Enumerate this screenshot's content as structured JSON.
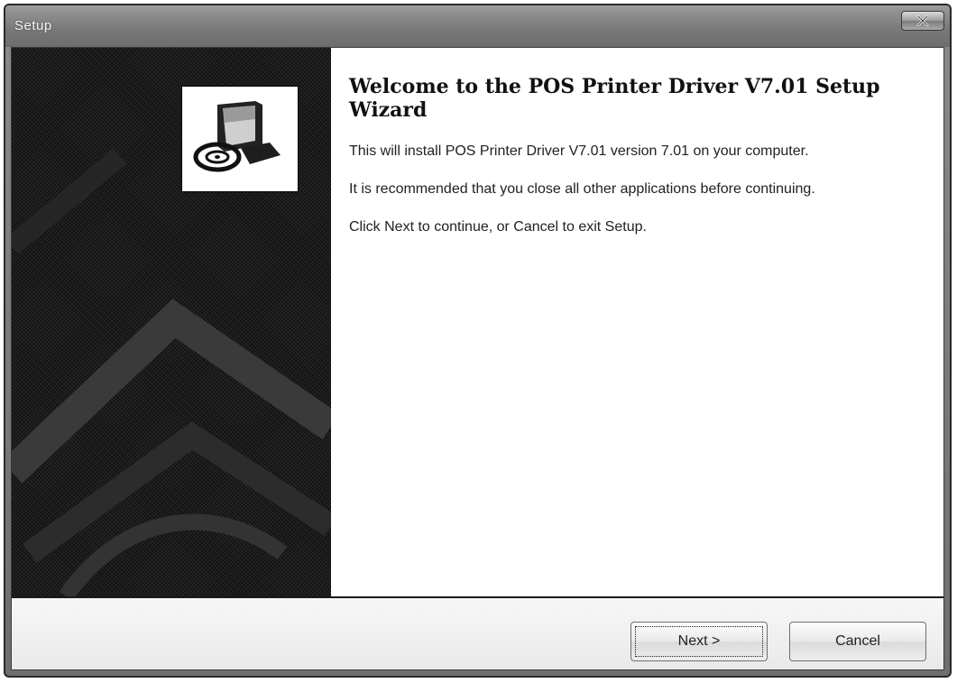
{
  "window": {
    "title": "Setup",
    "close_icon": "close-icon"
  },
  "side_panel": {
    "logo_icon": "computer-setup-icon"
  },
  "content": {
    "title": "Welcome to the POS Printer Driver V7.01 Setup Wizard",
    "paragraphs": [
      "This will install POS Printer Driver V7.01 version 7.01 on your computer.",
      "It is recommended that you close all other applications before continuing.",
      "Click Next to continue, or Cancel to exit Setup."
    ]
  },
  "buttons": {
    "next_label": "Next >",
    "cancel_label": "Cancel"
  },
  "colors": {
    "side_panel": "#121212",
    "footer": "#efefef",
    "titlebar": "#7a7a7a"
  }
}
